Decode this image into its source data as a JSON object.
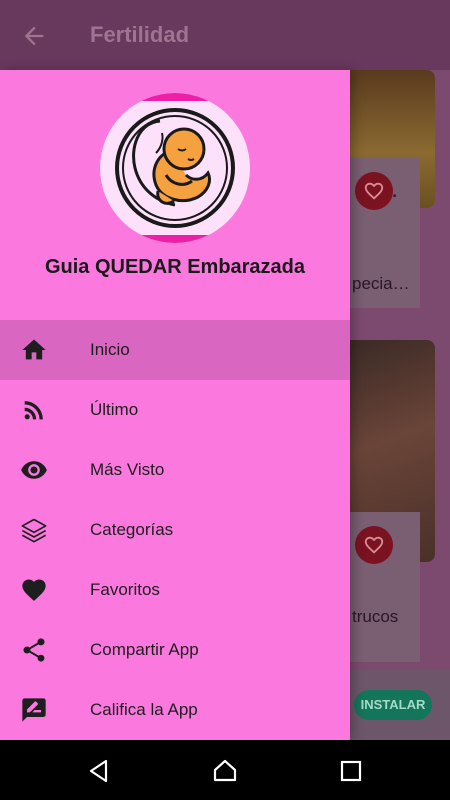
{
  "app_bar": {
    "title": "Fertilidad"
  },
  "background_cards": [
    {
      "text": "C."
    },
    {
      "text": "pecia…"
    },
    {
      "text": "trucos"
    }
  ],
  "ad": {
    "install_label": "INSTALAR"
  },
  "drawer": {
    "title": "Guia QUEDAR Embarazada",
    "items": [
      {
        "label": "Inicio",
        "icon": "home-icon",
        "active": true
      },
      {
        "label": "Último",
        "icon": "rss-icon"
      },
      {
        "label": "Más Visto",
        "icon": "eye-icon"
      },
      {
        "label": "Categorías",
        "icon": "layers-icon"
      },
      {
        "label": "Favoritos",
        "icon": "heart-icon"
      },
      {
        "label": "Compartir App",
        "icon": "share-icon"
      },
      {
        "label": "Califica la App",
        "icon": "rate-review-icon"
      }
    ]
  },
  "colors": {
    "drawer_bg": "#fb78de",
    "active_item_bg": "#d966c0",
    "app_bar_bg": "#68385d",
    "install_bg": "#13755a"
  }
}
